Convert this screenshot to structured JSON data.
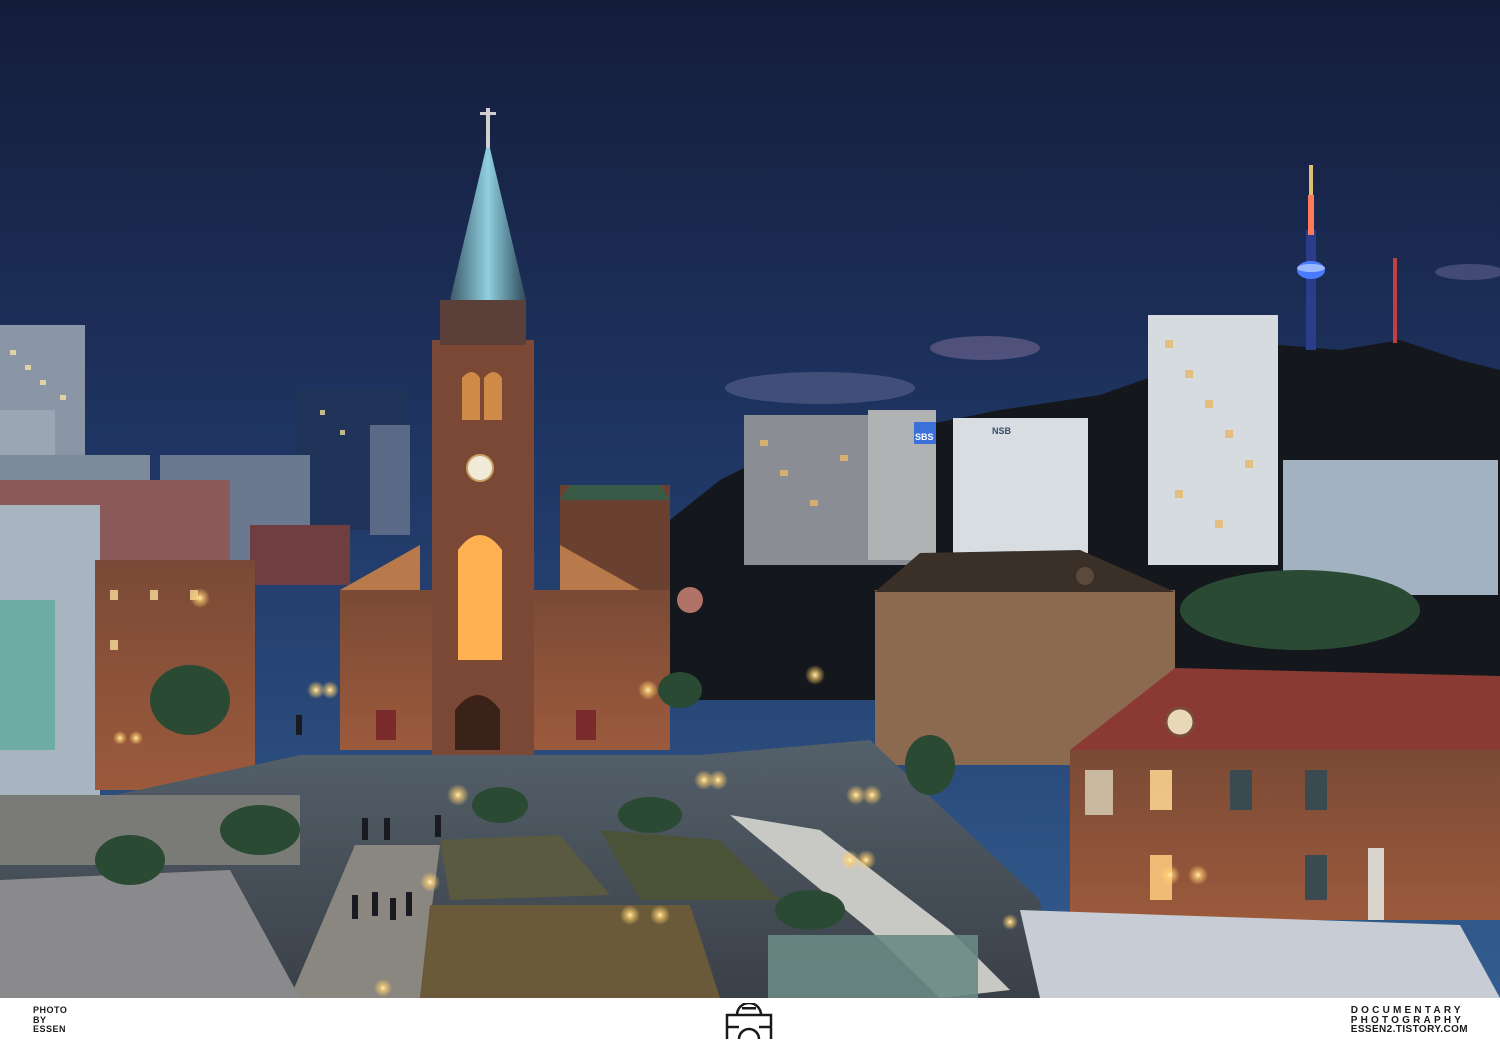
{
  "footer": {
    "left_lines": [
      "PHOTO",
      "BY",
      "ESSEN"
    ],
    "right_lines": [
      "DOCUMENTARY",
      "PHOTOGRAPHY",
      "ESSEN2.TISTORY.COM"
    ]
  },
  "scene": {
    "tower_sign": "NSB",
    "billboard": "SBS"
  },
  "colors": {
    "sky_top": "#141c3a",
    "sky_bottom": "#2f5a8e",
    "brick": "#8a4a32",
    "lamp": "#ffd27a",
    "tower_light": "#4a7bff"
  }
}
